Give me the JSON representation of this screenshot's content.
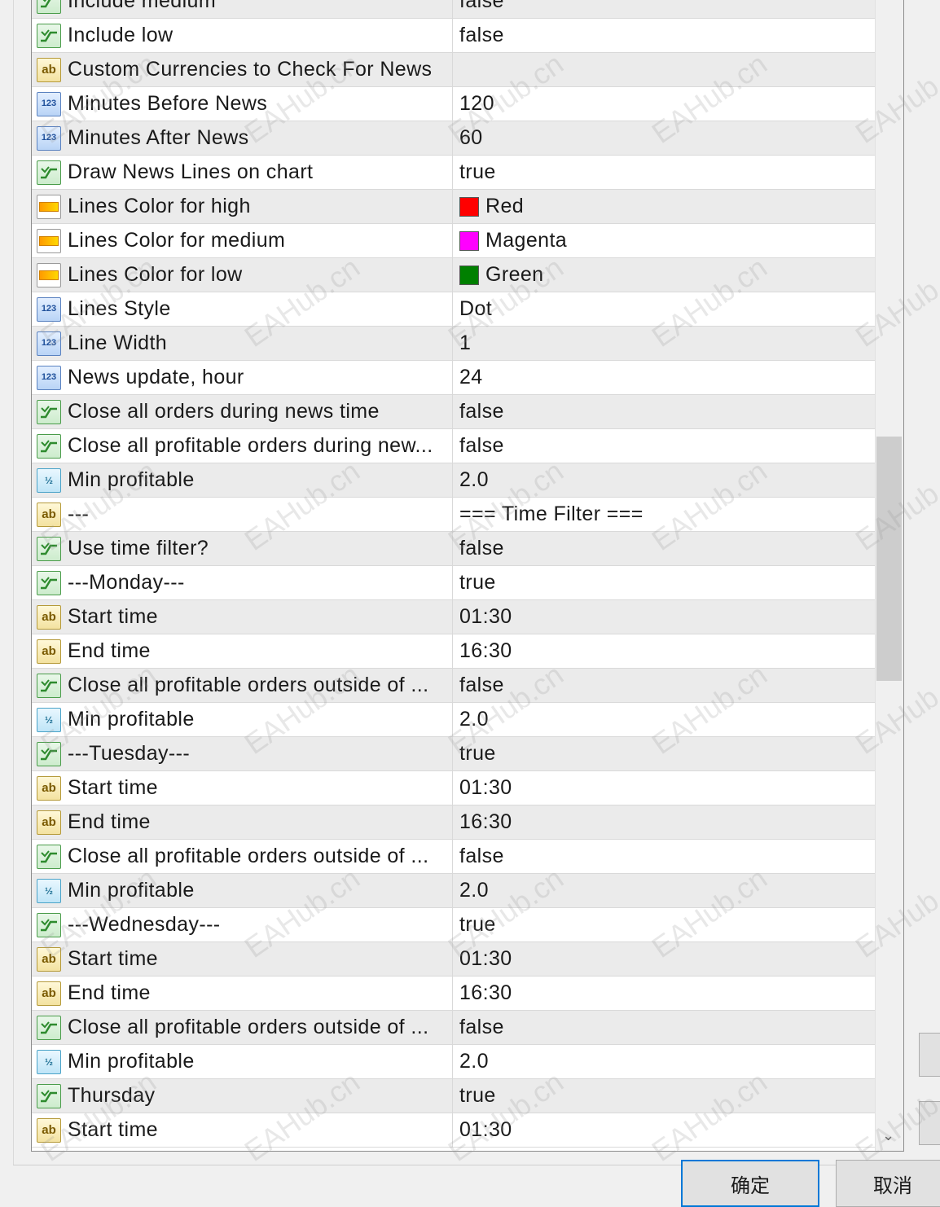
{
  "rows": [
    {
      "name": "Include medium",
      "value": "false",
      "type": "bool"
    },
    {
      "name": "Include low",
      "value": "false",
      "type": "bool"
    },
    {
      "name": "Custom Currencies to Check For News",
      "value": "",
      "type": "str"
    },
    {
      "name": "Minutes Before News",
      "value": "120",
      "type": "int"
    },
    {
      "name": "Minutes After News",
      "value": "60",
      "type": "int"
    },
    {
      "name": "Draw News Lines on chart",
      "value": "true",
      "type": "bool"
    },
    {
      "name": "Lines Color for high",
      "value": "Red",
      "type": "col",
      "swatch": "#ff0000"
    },
    {
      "name": "Lines Color for medium",
      "value": "Magenta",
      "type": "col",
      "swatch": "#ff00ff"
    },
    {
      "name": "Lines Color for low",
      "value": "Green",
      "type": "col",
      "swatch": "#008000"
    },
    {
      "name": "Lines Style",
      "value": "Dot",
      "type": "int"
    },
    {
      "name": "Line Width",
      "value": "1",
      "type": "int"
    },
    {
      "name": "News update, hour",
      "value": "24",
      "type": "int"
    },
    {
      "name": "Close all orders during news time",
      "value": "false",
      "type": "bool"
    },
    {
      "name": "Close all profitable orders during new...",
      "value": "false",
      "type": "bool"
    },
    {
      "name": "Min profitable",
      "value": "2.0",
      "type": "dbl"
    },
    {
      "name": "---",
      "value": "=== Time Filter ===",
      "type": "str"
    },
    {
      "name": "Use time filter?",
      "value": "false",
      "type": "bool"
    },
    {
      "name": "---Monday---",
      "value": "true",
      "type": "bool"
    },
    {
      "name": "Start time",
      "value": "01:30",
      "type": "str"
    },
    {
      "name": "End time",
      "value": "16:30",
      "type": "str"
    },
    {
      "name": "Close all profitable orders outside of ...",
      "value": "false",
      "type": "bool"
    },
    {
      "name": "Min profitable",
      "value": "2.0",
      "type": "dbl"
    },
    {
      "name": "---Tuesday---",
      "value": "true",
      "type": "bool"
    },
    {
      "name": "Start time",
      "value": "01:30",
      "type": "str"
    },
    {
      "name": "End time",
      "value": "16:30",
      "type": "str"
    },
    {
      "name": "Close all profitable orders outside of ...",
      "value": "false",
      "type": "bool"
    },
    {
      "name": "Min profitable",
      "value": "2.0",
      "type": "dbl"
    },
    {
      "name": "---Wednesday---",
      "value": "true",
      "type": "bool"
    },
    {
      "name": "Start time",
      "value": "01:30",
      "type": "str"
    },
    {
      "name": "End time",
      "value": "16:30",
      "type": "str"
    },
    {
      "name": "Close all profitable orders outside of ...",
      "value": "false",
      "type": "bool"
    },
    {
      "name": "Min profitable",
      "value": "2.0",
      "type": "dbl"
    },
    {
      "name": "Thursday",
      "value": "true",
      "type": "bool"
    },
    {
      "name": "Start time",
      "value": "01:30",
      "type": "str"
    }
  ],
  "buttons": {
    "ok": "确定",
    "cancel": "取消"
  },
  "watermark": "EAHub.cn",
  "icon_glyphs": {
    "str": "ab",
    "int": "123",
    "dbl": "½"
  }
}
